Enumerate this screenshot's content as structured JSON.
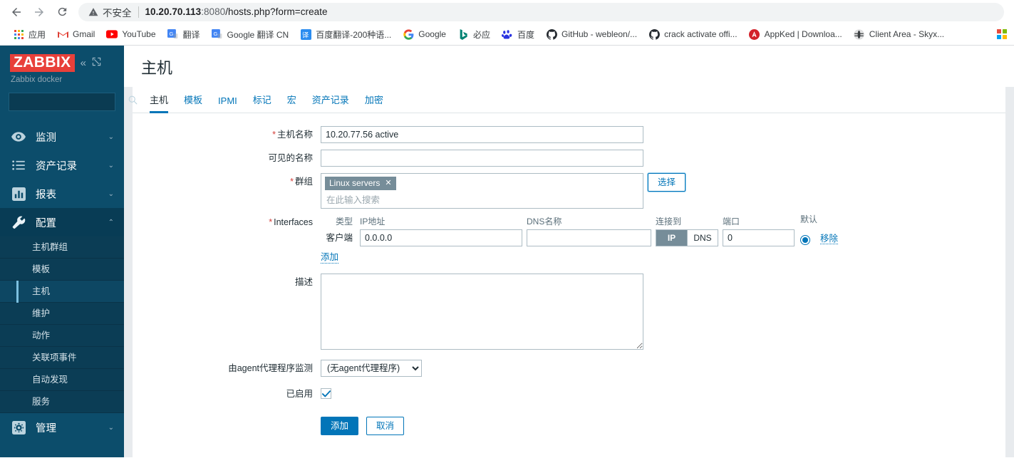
{
  "browser": {
    "nav": {
      "back": "back-arrow",
      "forward": "forward-arrow",
      "reload": "reload"
    },
    "security_label": "不安全",
    "url_host": "10.20.70.113",
    "url_port": ":8080",
    "url_path": "/hosts.php?form=create",
    "bookmarks": [
      {
        "label": "应用",
        "icon": "apps-grid-icon"
      },
      {
        "label": "Gmail",
        "icon": "gmail-icon"
      },
      {
        "label": "YouTube",
        "icon": "youtube-icon"
      },
      {
        "label": "翻译",
        "icon": "google-translate-icon"
      },
      {
        "label": "Google 翻译 CN",
        "icon": "google-translate-icon"
      },
      {
        "label": "百度翻译-200种语...",
        "icon": "baidu-translate-icon"
      },
      {
        "label": "Google",
        "icon": "google-icon"
      },
      {
        "label": "必应",
        "icon": "bing-icon"
      },
      {
        "label": "百度",
        "icon": "baidu-icon"
      },
      {
        "label": "GitHub - webleon/...",
        "icon": "github-icon"
      },
      {
        "label": "crack activate offi...",
        "icon": "github-icon"
      },
      {
        "label": "AppKed | Downloa...",
        "icon": "appked-icon"
      },
      {
        "label": "Client Area - Skyx...",
        "icon": "globe-icon"
      }
    ]
  },
  "sidebar": {
    "logo": "ZABBIX",
    "server_name": "Zabbix docker",
    "search_placeholder": "",
    "search_value": "",
    "collapse_label": "«",
    "menu": [
      {
        "label": "监测",
        "icon": "eye-icon",
        "chevron": "⌄",
        "state": "collapsed"
      },
      {
        "label": "资产记录",
        "icon": "list-icon",
        "chevron": "⌄",
        "state": "collapsed"
      },
      {
        "label": "报表",
        "icon": "bar-chart-icon",
        "chevron": "⌄",
        "state": "collapsed"
      },
      {
        "label": "配置",
        "icon": "wrench-icon",
        "chevron": "⌃",
        "state": "expanded"
      }
    ],
    "submenu": [
      {
        "label": "主机群组",
        "selected": false
      },
      {
        "label": "模板",
        "selected": false
      },
      {
        "label": "主机",
        "selected": true
      },
      {
        "label": "维护",
        "selected": false
      },
      {
        "label": "动作",
        "selected": false
      },
      {
        "label": "关联项事件",
        "selected": false
      },
      {
        "label": "自动发现",
        "selected": false
      },
      {
        "label": "服务",
        "selected": false
      }
    ],
    "bottom": {
      "label": "管理",
      "icon": "gear-icon",
      "chevron": "⌄"
    }
  },
  "page": {
    "title": "主机",
    "tabs": [
      {
        "label": "主机",
        "active": true
      },
      {
        "label": "模板",
        "active": false
      },
      {
        "label": "IPMI",
        "active": false
      },
      {
        "label": "标记",
        "active": false
      },
      {
        "label": "宏",
        "active": false
      },
      {
        "label": "资产记录",
        "active": false
      },
      {
        "label": "加密",
        "active": false
      }
    ]
  },
  "form": {
    "hostname": {
      "label": "主机名称",
      "required": true,
      "value": "10.20.77.56 active"
    },
    "visible_name": {
      "label": "可见的名称",
      "required": false,
      "value": "",
      "placeholder": ""
    },
    "groups": {
      "label": "群组",
      "required": true,
      "chips": [
        {
          "label": "Linux servers",
          "remove": "✕"
        }
      ],
      "placeholder": "在此输入搜索",
      "select_button": "选择"
    },
    "interfaces": {
      "label": "Interfaces",
      "required": true,
      "headers": {
        "type": "类型",
        "ip": "IP地址",
        "dns": "DNS名称",
        "connect": "连接到",
        "port": "端口",
        "default": "默认"
      },
      "rows": [
        {
          "type": "客户端",
          "ip": "0.0.0.0",
          "dns": "",
          "connect_options": [
            "IP",
            "DNS"
          ],
          "connect_selected": "IP",
          "port": "0",
          "default_selected": true,
          "remove_label": "移除"
        }
      ],
      "add_label": "添加"
    },
    "description": {
      "label": "描述",
      "value": "",
      "placeholder": ""
    },
    "proxy": {
      "label": "由agent代理程序监测",
      "selected": "(无agent代理程序)",
      "options": [
        "(无agent代理程序)"
      ]
    },
    "enabled": {
      "label": "已启用",
      "checked": true
    },
    "actions": {
      "submit": "添加",
      "cancel": "取消"
    }
  },
  "colors": {
    "accent": "#0275b8",
    "sidebar_bg": "#0c4d6b",
    "logo_red": "#e8403a",
    "chip_bg": "#768d99",
    "required_red": "#d43f3a"
  }
}
